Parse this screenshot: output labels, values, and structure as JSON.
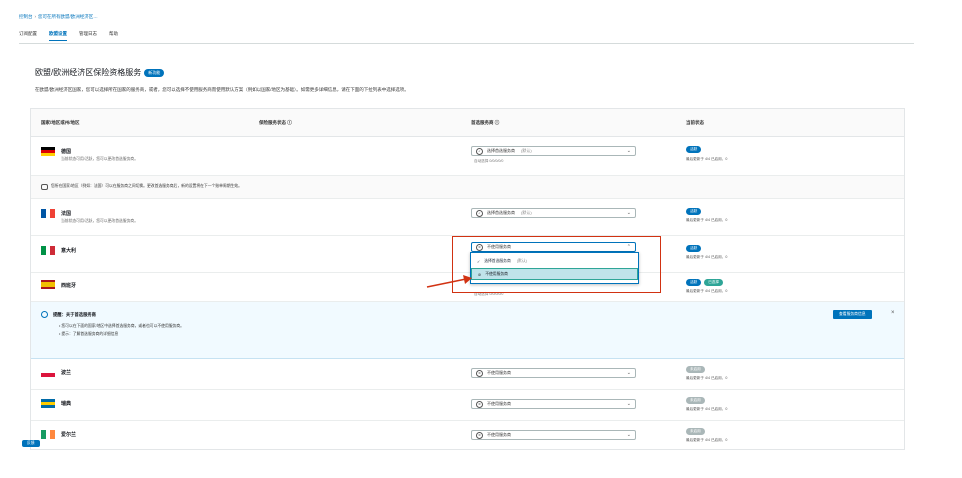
{
  "breadcrumb": [
    "控制台",
    "您可在所有欧盟/欧洲经济区…"
  ],
  "tabs": [
    {
      "label": "订阅配置",
      "active": false
    },
    {
      "label": "欧盟设置",
      "active": true
    },
    {
      "label": "管理日志",
      "active": false
    },
    {
      "label": "帮助",
      "active": false
    }
  ],
  "page": {
    "title": "欧盟/欧洲经济区保险资格服务",
    "title_badge": "新功能",
    "description": "在欧盟/欧洲经济区国家，您可以选择所在国家的服务商，或者，您可以选择不使用服务商而使用默认方案（例如以国家/地区为基础）。如需更多详细信息，请在下面的下拉列表中选择选项。"
  },
  "table": {
    "headers": [
      "国家/地区或州/地区",
      "保险服务状态",
      "首选服务商",
      "当前状态"
    ]
  },
  "rows": [
    {
      "flag": [
        "#000000",
        "#dd0000",
        "#ffce00"
      ],
      "flag_dir": "v",
      "name": "德国",
      "sub": "当前状态可用/活跃，您可以更改首选服务商。",
      "select": "选择首选服务商",
      "select_extra": "(默认)",
      "select_note": "自动选择 0/0/0/0/0",
      "status": [
        "活跃"
      ],
      "status_note": "最后更新于 4/4 已启用，0"
    },
    {
      "flag": [
        "#0055a4",
        "#ffffff",
        "#ef4135"
      ],
      "flag_dir": "h",
      "name": "法国",
      "sub": "当前状态可用/活跃，您可以更改首选服务商。",
      "select": "选择首选服务商",
      "select_extra": "(默认)",
      "select_note": "",
      "status": [
        "活跃"
      ],
      "status_note": "最后更新于 4/4 已启用，0"
    },
    {
      "flag": [
        "#009246",
        "#ffffff",
        "#ce2b37"
      ],
      "flag_dir": "h",
      "name": "意大利",
      "sub": "",
      "select": "不使用服务商",
      "select_extra": "",
      "select_note": "",
      "status": [
        "活跃"
      ],
      "status_note": "最后更新于 4/4 已启用，0"
    },
    {
      "flag": [
        "#aa151b",
        "#f1bf00",
        "#aa151b"
      ],
      "flag_dir": "v",
      "name": "西班牙",
      "sub": "",
      "select": "",
      "select_extra": "",
      "select_note": "自动选择 0/0/0/0/0",
      "status": [
        "活跃",
        "已选择"
      ],
      "status_note": "最后更新于 4/4 已启用，0"
    },
    {
      "flag": [
        "#ffffff",
        "#dc143c"
      ],
      "flag_dir": "v",
      "name": "波兰",
      "sub": "",
      "select": "不使用服务商",
      "select_extra": "",
      "select_note": "",
      "status": [
        "未启用"
      ],
      "status_note": "最后更新于 4/4 已启用，0"
    },
    {
      "flag": [
        "#006aa7",
        "#fecc00",
        "#006aa7"
      ],
      "flag_dir": "v",
      "name": "瑞典",
      "sub": "",
      "select": "不使用服务商",
      "select_extra": "",
      "select_note": "",
      "status": [
        "未启用"
      ],
      "status_note": "最后更新于 4/4 已启用，0"
    },
    {
      "flag": [
        "#169b62",
        "#ffffff",
        "#ff883e"
      ],
      "flag_dir": "h",
      "name": "爱尔兰",
      "sub": "",
      "select": "不使用服务商",
      "select_extra": "",
      "select_note": "",
      "status": [
        "未启用"
      ],
      "status_note": "最后更新于 4/4 已启用，0"
    }
  ],
  "notice": "您所在国家/地区（例如：法国）可以在服务商之间切换。更改首选服务商后，新的设置将在下一个账单周期生效。",
  "info": {
    "title": "提醒：关于首选服务商",
    "line1": "• 您可以在下面的国家/地区中选择首选服务商，或者也可以不使用服务商。",
    "line2": "• 提示：了解首选服务商的详细信息",
    "button": "查看服务商信息",
    "close": "×"
  },
  "dropdown": {
    "options": [
      {
        "label": "选择首选服务商",
        "extra": "(默认)",
        "highlighted": false
      },
      {
        "label": "不使用服务商",
        "extra": "",
        "highlighted": true
      }
    ]
  },
  "corner_badge": "反馈",
  "colors": {
    "accent": "#0073bb",
    "highlight": "#d13212",
    "teal": "#2ea597"
  }
}
